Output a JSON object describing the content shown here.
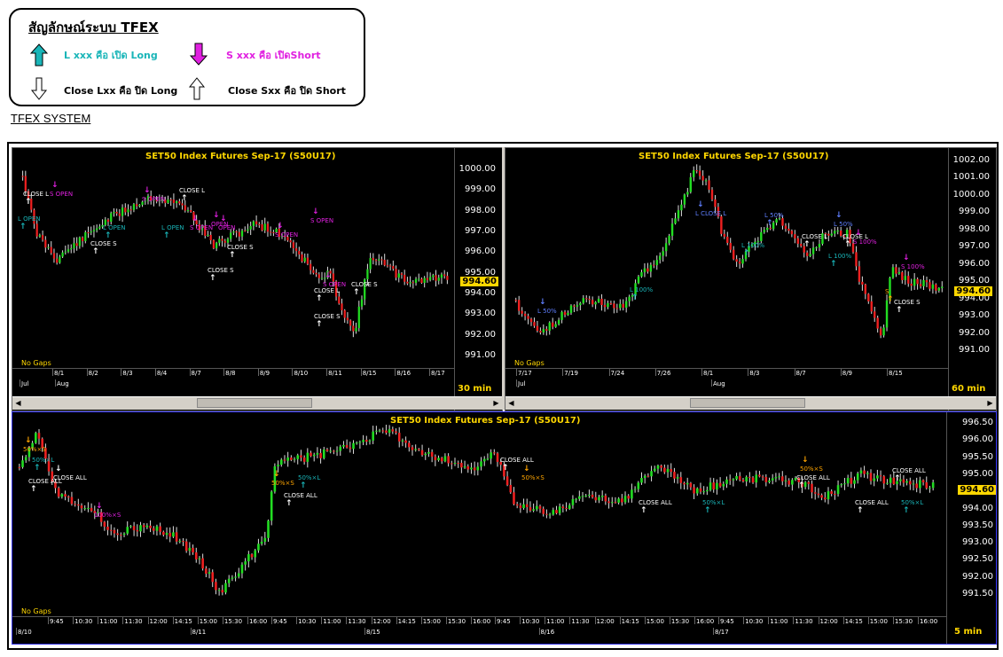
{
  "legend": {
    "title": "สัญลักษณ์ระบบ TFEX",
    "long_open": "L xxx คือ เปิด Long",
    "short_open": "S xxx คือ เปิดShort",
    "close_long": "Close Lxx คือ ปิด Long",
    "close_short": "Close Sxx คือ ปิด Short",
    "colors": {
      "long": "#19b5b8",
      "short": "#e020e0"
    }
  },
  "system_title": "TFEX SYSTEM",
  "panels": {
    "p1": {
      "title": "SET50  Index Futures  Sep-17  (S50U17)",
      "timeframe": "30  min",
      "no_gaps": "No Gaps",
      "last_price": "994.60",
      "y_ticks": [
        "1000.00",
        "999.00",
        "998.00",
        "997.00",
        "996.00",
        "995.00",
        "994.00",
        "993.00",
        "992.00",
        "991.00"
      ],
      "date_labels": [
        "8/1",
        "8/2",
        "8/3",
        "8/4",
        "8/7",
        "8/8",
        "8/9",
        "8/10",
        "8/11",
        "8/15",
        "8/16",
        "8/17"
      ],
      "month_labels": [
        "Jul",
        "Aug"
      ],
      "signals": [
        {
          "text": "CLOSE L",
          "color": "#fff"
        },
        {
          "text": "S OPEN",
          "color": "#e020e0"
        },
        {
          "text": "L OPEN",
          "color": "#19b5b8"
        },
        {
          "text": "CLOSE L",
          "color": "#fff"
        },
        {
          "text": "S OPEN",
          "color": "#e020e0"
        },
        {
          "text": "L OPEN",
          "color": "#19b5b8"
        },
        {
          "text": "L OPEN",
          "color": "#19b5b8"
        },
        {
          "text": "S OPEN",
          "color": "#e020e0"
        },
        {
          "text": "OPEN",
          "color": "#e020e0"
        },
        {
          "text": "CLOSE S",
          "color": "#fff"
        },
        {
          "text": "CLOSE S",
          "color": "#fff"
        },
        {
          "text": "CLOSE S",
          "color": "#fff"
        },
        {
          "text": "S OPEN",
          "color": "#e020e0"
        },
        {
          "text": "S OPEN",
          "color": "#e020e0"
        },
        {
          "text": "CLOSE L",
          "color": "#fff"
        },
        {
          "text": "S OPEN",
          "color": "#e020e0"
        },
        {
          "text": "CLOSE S",
          "color": "#fff"
        },
        {
          "text": "CLOSE S",
          "color": "#fff"
        },
        {
          "text": "OPEN",
          "color": "#e020e0"
        }
      ]
    },
    "p2": {
      "title": "SET50  Index Futures  Sep-17  (S50U17)",
      "timeframe": "60  min",
      "no_gaps": "No Gaps",
      "last_price": "994.60",
      "y_ticks": [
        "1002.00",
        "1001.00",
        "1000.00",
        "999.00",
        "998.00",
        "997.00",
        "996.00",
        "995.00",
        "994.00",
        "993.00",
        "992.00",
        "991.00"
      ],
      "date_labels": [
        "7/17",
        "7/19",
        "7/24",
        "7/26",
        "8/1",
        "8/3",
        "8/7",
        "8/9",
        "8/15"
      ],
      "month_labels": [
        "Jul",
        "Aug"
      ],
      "signals": [
        {
          "text": "L 50%",
          "color": "#5f7fff"
        },
        {
          "text": "L 100%",
          "color": "#19b5b8"
        },
        {
          "text": "L CLOSE L",
          "color": "#5f7fff"
        },
        {
          "text": "L 50%",
          "color": "#5f7fff"
        },
        {
          "text": "L 100%",
          "color": "#19b5b8"
        },
        {
          "text": "CLOSE L",
          "color": "#fff"
        },
        {
          "text": "L 50%",
          "color": "#5f7fff"
        },
        {
          "text": "CLOSE L",
          "color": "#fff"
        },
        {
          "text": "L 100%",
          "color": "#19b5b8"
        },
        {
          "text": "S 100%",
          "color": "#e020e0"
        },
        {
          "text": "S 100%",
          "color": "#e020e0"
        },
        {
          "text": "S",
          "color": "#ffa500"
        },
        {
          "text": "CLOSE S",
          "color": "#fff"
        }
      ]
    },
    "p3": {
      "title": "SET50  Index Futures  Sep-17  (S50U17)",
      "timeframe": "5  min",
      "no_gaps": "No Gaps",
      "last_price": "994.60",
      "y_ticks": [
        "996.50",
        "996.00",
        "995.50",
        "995.00",
        "994.50",
        "994.00",
        "993.50",
        "993.00",
        "992.50",
        "992.00",
        "991.50"
      ],
      "date_labels": [
        "8/10",
        "8/11",
        "8/15",
        "8/16",
        "8/17"
      ],
      "time_labels": [
        "9:45",
        "10:30",
        "11:00",
        "11:30",
        "12:00",
        "14:15",
        "15:00",
        "15:30",
        "16:00"
      ],
      "signals": [
        {
          "text": "50%×S",
          "color": "#ffa500"
        },
        {
          "text": "50%×L",
          "color": "#19b5b8"
        },
        {
          "text": "CLOSE ALL",
          "color": "#fff"
        },
        {
          "text": "CLOSE ALL",
          "color": "#fff"
        },
        {
          "text": "100%×S",
          "color": "#e020e0"
        },
        {
          "text": "50%×S",
          "color": "#ffa500"
        },
        {
          "text": "50%×L",
          "color": "#19b5b8"
        },
        {
          "text": "CLOSE  ALL",
          "color": "#fff"
        },
        {
          "text": "CLOSE  ALL",
          "color": "#fff"
        },
        {
          "text": "50%×S",
          "color": "#ffa500"
        },
        {
          "text": "CLOSE  ALL",
          "color": "#fff"
        },
        {
          "text": "50%×L",
          "color": "#19b5b8"
        },
        {
          "text": "50%×S",
          "color": "#ffa500"
        },
        {
          "text": "CLOSE  ALL",
          "color": "#fff"
        },
        {
          "text": "CLOSE  ALL",
          "color": "#fff"
        },
        {
          "text": "CLOSE ALL",
          "color": "#fff"
        },
        {
          "text": "50%×L",
          "color": "#19b5b8"
        }
      ]
    }
  }
}
